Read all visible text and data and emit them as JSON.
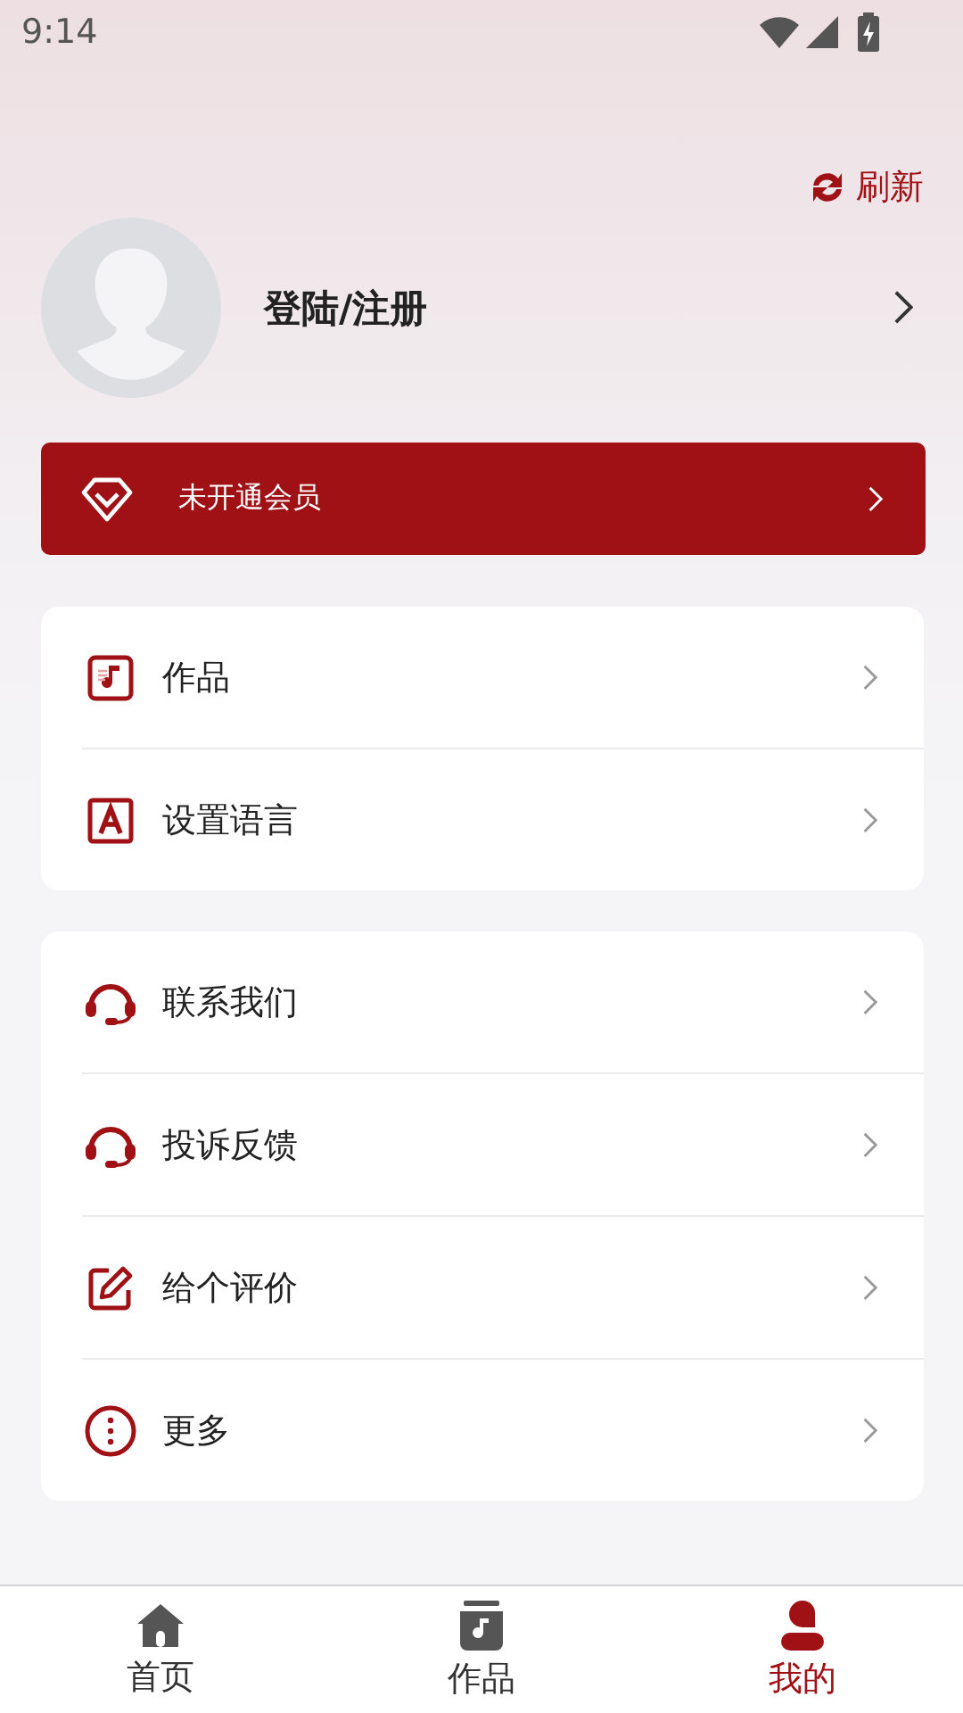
{
  "status_bar": {
    "time": "9:14"
  },
  "refresh": {
    "label": "刷新"
  },
  "profile": {
    "name": "登陆/注册"
  },
  "membership": {
    "label": "未开通会员"
  },
  "menu_groups": [
    {
      "items": [
        {
          "label": "作品"
        },
        {
          "label": "设置语言"
        }
      ]
    },
    {
      "items": [
        {
          "label": "联系我们"
        },
        {
          "label": "投诉反馈"
        },
        {
          "label": "给个评价"
        },
        {
          "label": "更多"
        }
      ]
    }
  ],
  "tab_bar": [
    {
      "label": "首页",
      "selected": false
    },
    {
      "label": "作品",
      "selected": false
    },
    {
      "label": "我的",
      "selected": true
    }
  ]
}
